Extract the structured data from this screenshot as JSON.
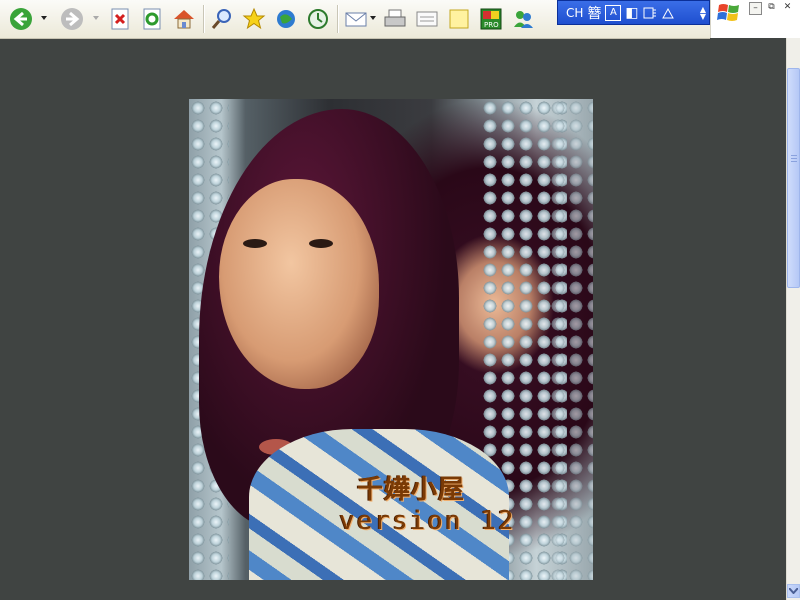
{
  "ime": {
    "lang": "CH",
    "char": "簪",
    "mode1": "A",
    "mode2": "◧"
  },
  "photo": {
    "caption_title": "千嬅小屋",
    "caption_version": "version 12"
  },
  "colors": {
    "background": "#404442",
    "caption": "#7a3a05",
    "ime_blue": "#2454d8"
  },
  "icons": [
    "back-icon",
    "forward-icon",
    "stop-icon",
    "refresh-icon",
    "home-icon",
    "search-icon",
    "favorites-icon",
    "media-icon",
    "history-icon",
    "mail-icon",
    "print-icon",
    "edit-icon",
    "discuss-icon",
    "pro-icon",
    "messenger-icon",
    "windows-logo-icon"
  ]
}
